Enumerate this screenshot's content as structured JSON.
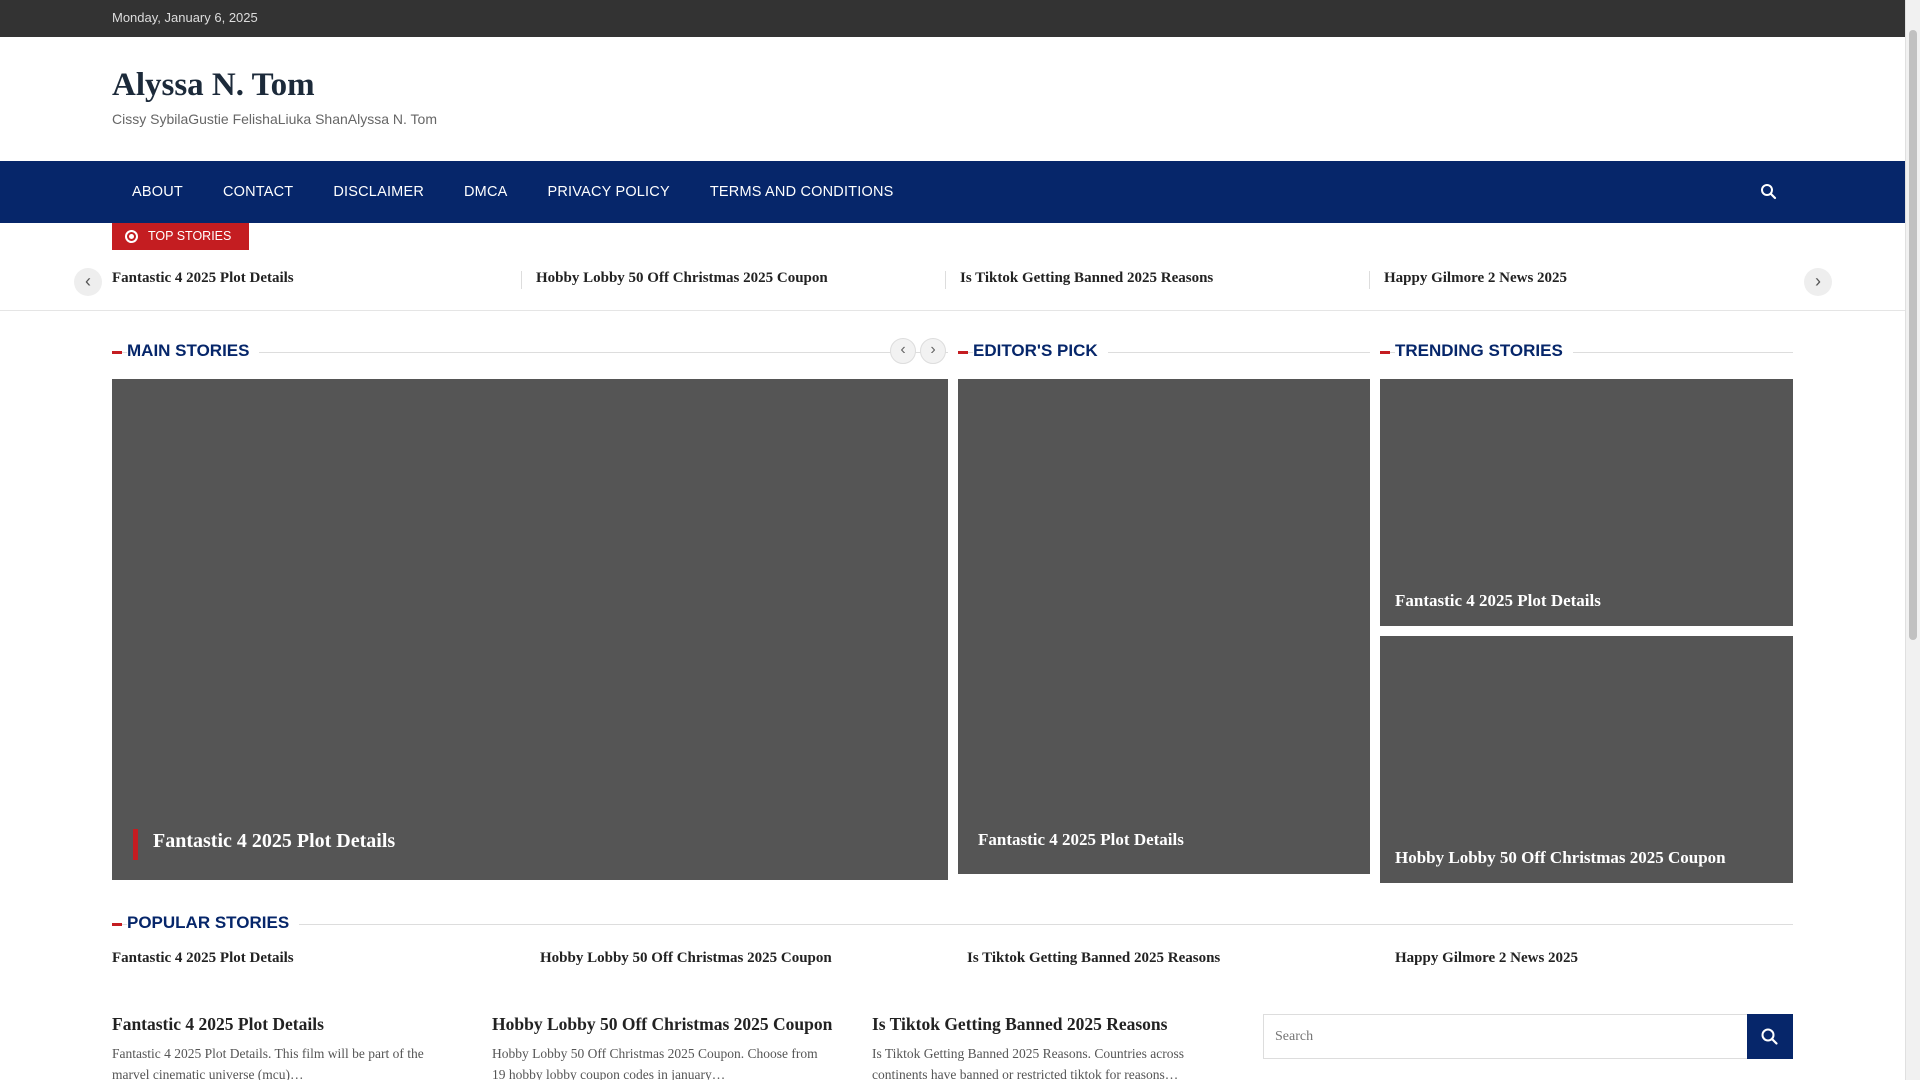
{
  "topbar": {
    "date": "Monday, January 6, 2025"
  },
  "header": {
    "site_title": "Alyssa N. Tom",
    "site_description": "Cissy SybilaGustie FelishaLiuka ShanAlyssa N. Tom"
  },
  "nav": {
    "items": [
      "ABOUT",
      "CONTACT",
      "DISCLAIMER",
      "DMCA",
      "PRIVACY POLICY",
      "TERMS AND CONDITIONS"
    ],
    "search_icon": "search-icon"
  },
  "ticker": {
    "label": "TOP STORIES",
    "items": [
      "Fantastic 4 2025 Plot Details",
      "Hobby Lobby 50 Off Christmas 2025 Coupon",
      "Is Tiktok Getting Banned 2025 Reasons",
      "Happy Gilmore 2 News 2025"
    ]
  },
  "main_stories": {
    "title": "MAIN STORIES",
    "featured_caption": "Fantastic 4 2025 Plot Details"
  },
  "editors_pick": {
    "title": "EDITOR'S PICK",
    "caption": "Fantastic 4 2025 Plot Details"
  },
  "trending": {
    "title": "TRENDING STORIES",
    "items": [
      "Fantastic 4 2025 Plot Details",
      "Hobby Lobby 50 Off Christmas 2025 Coupon"
    ]
  },
  "popular": {
    "title": "POPULAR STORIES",
    "items": [
      "Fantastic 4 2025 Plot Details",
      "Hobby Lobby 50 Off Christmas 2025 Coupon",
      "Is Tiktok Getting Banned 2025 Reasons",
      "Happy Gilmore 2 News 2025"
    ]
  },
  "posts": [
    {
      "title": "Fantastic 4 2025 Plot Details",
      "excerpt_1": "Fantastic 4 2025 Plot Details. This film will be part of the",
      "excerpt_2": "marvel cinematic universe (mcu)…"
    },
    {
      "title": "Hobby Lobby 50 Off Christmas 2025 Coupon",
      "excerpt_1": "Hobby Lobby 50 Off Christmas 2025 Coupon. Choose from",
      "excerpt_2": "19 hobby lobby coupon codes in january…"
    },
    {
      "title": "Is Tiktok Getting Banned 2025 Reasons",
      "excerpt_1": "Is Tiktok Getting Banned 2025 Reasons. Countries across",
      "excerpt_2": "continents have banned or restricted tiktok for reasons…"
    }
  ],
  "search_widget": {
    "placeholder": "Search"
  },
  "colors": {
    "topbar": "#333333",
    "nav": "#06266a",
    "accent": "#c41d21",
    "card": "#555555"
  }
}
